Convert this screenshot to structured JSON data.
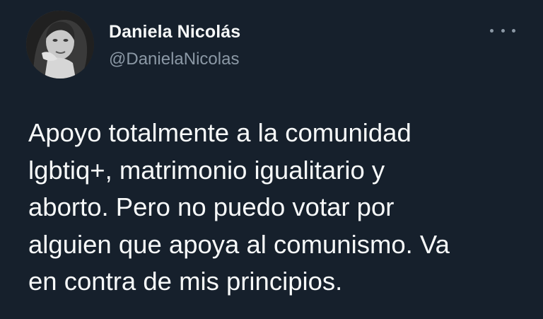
{
  "tweet": {
    "author": {
      "display_name": "Daniela Nicolás",
      "handle": "@DanielaNicolas"
    },
    "more_icon": "more-horizontal-icon",
    "body_lines": [
      "Apoyo totalmente a la comunidad",
      "lgbtiq+, matrimonio igualitario y",
      "aborto. Pero no puedo votar por",
      "alguien que apoya al comunismo. Va",
      "en contra de mis principios."
    ]
  },
  "colors": {
    "background": "#16202c",
    "primary_text": "#f7f9f9",
    "secondary_text": "#8b98a5"
  }
}
